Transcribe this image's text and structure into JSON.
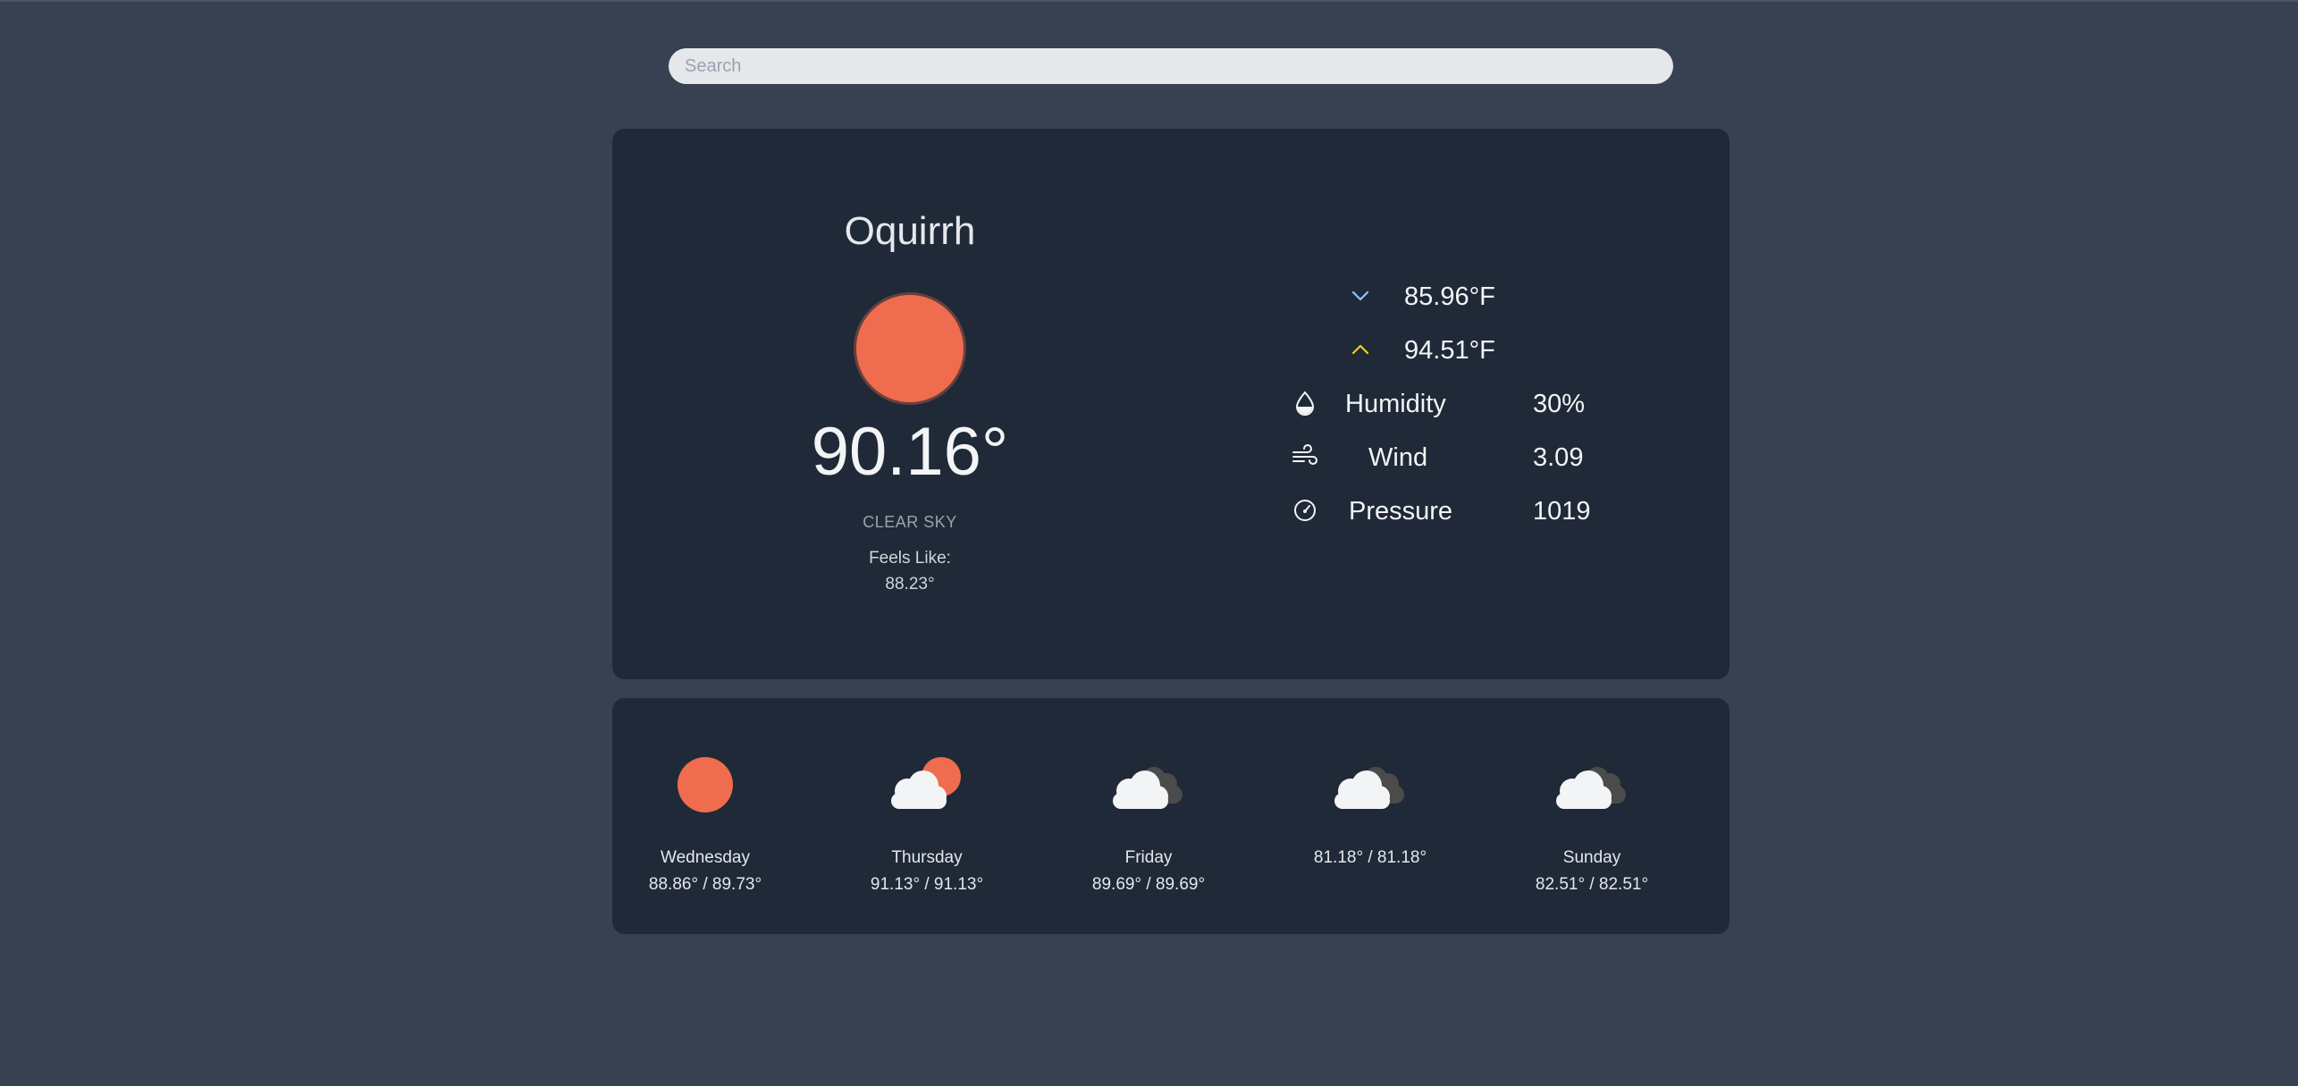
{
  "search": {
    "placeholder": "Search"
  },
  "current": {
    "city": "Oquirrh",
    "temperature": "90.16°",
    "description": "CLEAR SKY",
    "feels_like_label": "Feels Like:",
    "feels_like_value": "88.23°",
    "icon": "sun-icon"
  },
  "stats": {
    "min": {
      "value": "85.96°F",
      "icon": "chevron-down-icon"
    },
    "max": {
      "value": "94.51°F",
      "icon": "chevron-up-icon"
    },
    "humidity": {
      "label": "Humidity",
      "value": "30%",
      "icon": "water-drop-icon"
    },
    "wind": {
      "label": "Wind",
      "value": "3.09",
      "icon": "wind-icon"
    },
    "pressure": {
      "label": "Pressure",
      "value": "1019",
      "icon": "gauge-icon"
    }
  },
  "forecast": [
    {
      "day": "Wednesday",
      "range": "88.86° / 89.73°",
      "icon": "sun-icon"
    },
    {
      "day": "Thursday",
      "range": "91.13° / 91.13°",
      "icon": "partly-cloudy-icon"
    },
    {
      "day": "Friday",
      "range": "89.69° / 89.69°",
      "icon": "cloudy-icon"
    },
    {
      "day": "",
      "range": "81.18° / 81.18°",
      "icon": "cloudy-icon"
    },
    {
      "day": "Sunday",
      "range": "82.51° / 82.51°",
      "icon": "cloudy-icon"
    }
  ],
  "colors": {
    "background": "#374151",
    "card": "#1f2937",
    "sun": "#ef6c4e",
    "max_chevron": "#facc15",
    "min_chevron": "#93c5fd"
  }
}
